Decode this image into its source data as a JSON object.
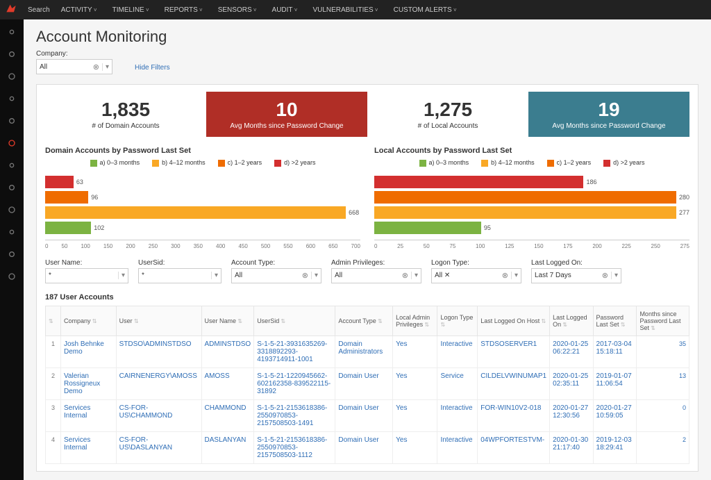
{
  "topnav": {
    "search": "Search",
    "items": [
      "ACTIVITY",
      "TIMELINE",
      "REPORTS",
      "SENSORS",
      "AUDIT",
      "VULNERABILITIES",
      "CUSTOM ALERTS"
    ]
  },
  "page": {
    "title": "Account Monitoring",
    "company_label": "Company:",
    "company_value": "All",
    "hide_filters": "Hide Filters"
  },
  "kpis": [
    {
      "value": "1,835",
      "caption": "# of Domain Accounts",
      "class": ""
    },
    {
      "value": "10",
      "caption": "Avg Months since Password Change",
      "class": "red"
    },
    {
      "value": "1,275",
      "caption": "# of Local Accounts",
      "class": ""
    },
    {
      "value": "19",
      "caption": "Avg Months since Password Change",
      "class": "blue"
    }
  ],
  "legend": [
    "a) 0–3 months",
    "b) 4–12 months",
    "c) 1–2 years",
    "d) >2 years"
  ],
  "chart_data": [
    {
      "type": "bar",
      "title": "Domain Accounts by Password Last Set",
      "orientation": "horizontal",
      "categories": [
        "a) 0–3 months",
        "b) 4–12 months",
        "c) 1–2 years",
        "d) >2 years"
      ],
      "colors": [
        "#d32f2f",
        "#ef6c00",
        "#f9a825",
        "#7cb342"
      ],
      "values": [
        63,
        96,
        668,
        102
      ],
      "xlim": [
        0,
        700
      ],
      "xticks": [
        0,
        50,
        100,
        150,
        200,
        250,
        300,
        350,
        400,
        450,
        500,
        550,
        600,
        650,
        700
      ]
    },
    {
      "type": "bar",
      "title": "Local Accounts by Password Last Set",
      "orientation": "horizontal",
      "categories": [
        "a) 0–3 months",
        "b) 4–12 months",
        "c) 1–2 years",
        "d) >2 years"
      ],
      "colors": [
        "#d32f2f",
        "#ef6c00",
        "#f9a825",
        "#7cb342"
      ],
      "values": [
        186,
        280,
        277,
        95
      ],
      "xlim": [
        0,
        280
      ],
      "xticks": [
        0,
        25,
        50,
        75,
        100,
        125,
        150,
        175,
        200,
        225,
        250,
        275
      ]
    }
  ],
  "filters2": [
    {
      "label": "User Name:",
      "value": "*"
    },
    {
      "label": "UserSid:",
      "value": "*"
    },
    {
      "label": "Account Type:",
      "value": "All"
    },
    {
      "label": "Admin Privileges:",
      "value": "All"
    },
    {
      "label": "Logon Type:",
      "value": "All ✕"
    },
    {
      "label": "Last Logged On:",
      "value": "Last 7 Days"
    }
  ],
  "table": {
    "title": "187 User Accounts",
    "columns": [
      "",
      "Company",
      "User",
      "User Name",
      "UserSid",
      "Account Type",
      "Local Admin Privileges",
      "Logon Type",
      "Last Logged On Host",
      "Last Logged On",
      "Password Last Set",
      "Months since Password Last Set"
    ],
    "rows": [
      {
        "n": "1",
        "company": "Josh Behnke Demo",
        "user": "STDSO\\ADMINSTDSO",
        "uname": "ADMINSTDSO",
        "sid": "S-1-5-21-3931635269-3318892293-4193714911-1001",
        "atype": "Domain Administrators",
        "admin": "Yes",
        "logon": "Interactive",
        "host": "STDSOSERVER1",
        "lastlog": "2020-01-25 06:22:21",
        "pls": "2017-03-04 15:18:11",
        "months": "35"
      },
      {
        "n": "2",
        "company": "Valerian Rossigneux Demo",
        "user": "CAIRNENERGY\\AMOSS",
        "uname": "AMOSS",
        "sid": "S-1-5-21-1220945662-602162358-839522115-31892",
        "atype": "Domain User",
        "admin": "Yes",
        "logon": "Service",
        "host": "CILDELVWINUMAP1",
        "lastlog": "2020-01-25 02:35:11",
        "pls": "2019-01-07 11:06:54",
        "months": "13"
      },
      {
        "n": "3",
        "company": "Services Internal",
        "user": "CS-FOR-US\\CHAMMOND",
        "uname": "CHAMMOND",
        "sid": "S-1-5-21-2153618386-2550970853-2157508503-1491",
        "atype": "Domain User",
        "admin": "Yes",
        "logon": "Interactive",
        "host": "FOR-WIN10V2-018",
        "lastlog": "2020-01-27 12:30:56",
        "pls": "2020-01-27 10:59:05",
        "months": "0"
      },
      {
        "n": "4",
        "company": "Services Internal",
        "user": "CS-FOR-US\\DASLANYAN",
        "uname": "DASLANYAN",
        "sid": "S-1-5-21-2153618386-2550970853-2157508503-1112",
        "atype": "Domain User",
        "admin": "Yes",
        "logon": "Interactive",
        "host": "04WPFORTESTVM-",
        "lastlog": "2020-01-30 21:17:40",
        "pls": "2019-12-03 18:29:41",
        "months": "2"
      }
    ]
  }
}
